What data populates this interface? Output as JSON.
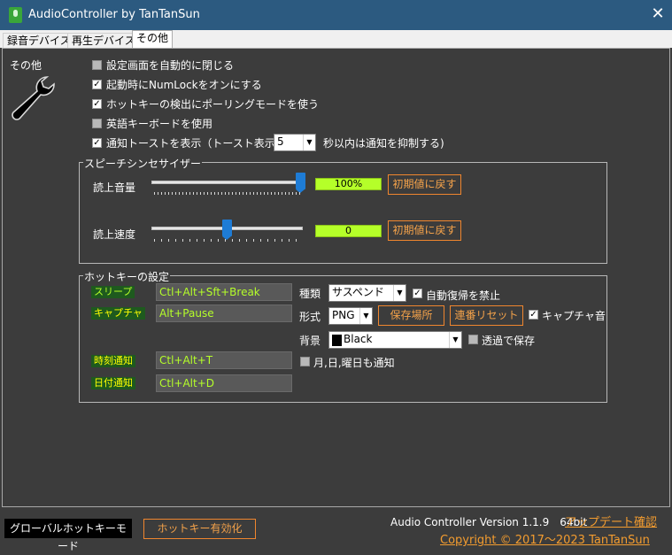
{
  "window": {
    "title": "AudioController by TanTanSun",
    "close_glyph": "✕"
  },
  "tabs": [
    {
      "label": "録音デバイス"
    },
    {
      "label": "再生デバイス"
    },
    {
      "label": "その他"
    }
  ],
  "general": {
    "section_label": "その他",
    "options": [
      {
        "label": "設定画面を自動的に閉じる",
        "checked": false
      },
      {
        "label": "起動時にNumLockをオンにする",
        "checked": true
      },
      {
        "label": "ホットキーの検出にポーリングモードを使う",
        "checked": true
      },
      {
        "label": "英語キーボードを使用",
        "checked": false
      },
      {
        "label": "通知トーストを表示（トースト表示から",
        "checked": true
      }
    ],
    "toast_seconds": "5",
    "toast_suffix": "秒以内は通知を抑制する)"
  },
  "speech": {
    "group_title": "スピーチシンセサイザー",
    "volume": {
      "label": "読上音量",
      "value_text": "100%",
      "level_percent": 100,
      "reset_label": "初期値に戻す"
    },
    "speed": {
      "label": "読上速度",
      "value_text": "0",
      "level_percent": 50,
      "reset_label": "初期値に戻す"
    }
  },
  "hotkeys": {
    "group_title": "ホットキーの設定",
    "rows": [
      {
        "tag": "スリープ",
        "keys": "Ctl+Alt+Sft+Break"
      },
      {
        "tag": "キャプチャ",
        "keys": "Alt+Pause"
      },
      {
        "tag": "時刻通知",
        "keys": "Ctl+Alt+T"
      },
      {
        "tag": "日付通知",
        "keys": "Ctl+Alt+D"
      }
    ],
    "type_label": "種類",
    "type_value": "サスペンド",
    "no_auto_resume_label": "自動復帰を禁止",
    "format_label": "形式",
    "format_value": "PNG",
    "save_location_label": "保存場所",
    "serial_reset_label": "連番リセット",
    "capture_sound_label": "キャプチャ音",
    "background_label": "背景",
    "background_value": "Black",
    "transparent_save_label": "透過で保存",
    "date_weekday_label": "月,日,曜日も通知"
  },
  "footer": {
    "mode_label": "グローバルホットキーモード",
    "hotkey_enable_label": "ホットキー有効化",
    "version_text": "Audio Controller Version 1.1.9　64bit",
    "update_link": "アップデート確認",
    "copyright": "Copyright © 2017～2023 TanTanSun"
  },
  "colors": {
    "titlebar": "#2c5a80",
    "panel_bg": "#3c3c3c",
    "accent_orange": "#f0862e",
    "lime": "#b5ff29",
    "slider_blue": "#1e7cd6"
  }
}
